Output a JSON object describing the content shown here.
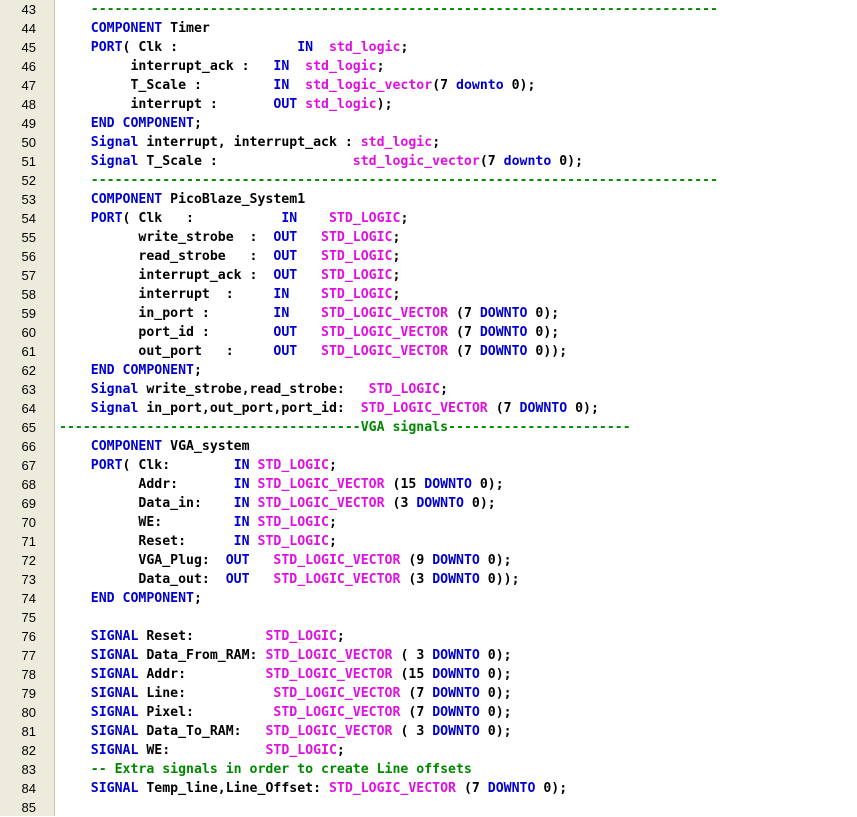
{
  "editor": {
    "colors": {
      "keyword": "#0000cc",
      "type": "#e010e0",
      "comment": "#008800",
      "text": "#000000",
      "gutter": "#ecebdc"
    },
    "lines": [
      {
        "n": "43",
        "t": [
          [
            "cm",
            "    -------------------------------------------------------------------------------"
          ]
        ]
      },
      {
        "n": "44",
        "t": [
          [
            "kw",
            "    COMPONENT"
          ],
          [
            "tx",
            " Timer"
          ]
        ]
      },
      {
        "n": "45",
        "t": [
          [
            "kw",
            "    PORT"
          ],
          [
            "tx",
            "( Clk :               "
          ],
          [
            "kw",
            "IN"
          ],
          [
            "tx",
            "  "
          ],
          [
            "ty",
            "std_logic"
          ],
          [
            "tx",
            ";"
          ]
        ]
      },
      {
        "n": "46",
        "t": [
          [
            "tx",
            "         interrupt_ack :   "
          ],
          [
            "kw",
            "IN"
          ],
          [
            "tx",
            "  "
          ],
          [
            "ty",
            "std_logic"
          ],
          [
            "tx",
            ";"
          ]
        ]
      },
      {
        "n": "47",
        "t": [
          [
            "tx",
            "         T_Scale :         "
          ],
          [
            "kw",
            "IN"
          ],
          [
            "tx",
            "  "
          ],
          [
            "ty",
            "std_logic_vector"
          ],
          [
            "tx",
            "(7 "
          ],
          [
            "kw",
            "downto"
          ],
          [
            "tx",
            " 0);"
          ]
        ]
      },
      {
        "n": "48",
        "t": [
          [
            "tx",
            "         interrupt :       "
          ],
          [
            "kw",
            "OUT"
          ],
          [
            "tx",
            " "
          ],
          [
            "ty",
            "std_logic"
          ],
          [
            "tx",
            ");"
          ]
        ]
      },
      {
        "n": "49",
        "t": [
          [
            "kw",
            "    END COMPONENT"
          ],
          [
            "tx",
            ";"
          ]
        ]
      },
      {
        "n": "50",
        "t": [
          [
            "kw",
            "    Signal"
          ],
          [
            "tx",
            " interrupt, interrupt_ack : "
          ],
          [
            "ty",
            "std_logic"
          ],
          [
            "tx",
            ";"
          ]
        ]
      },
      {
        "n": "51",
        "t": [
          [
            "kw",
            "    Signal"
          ],
          [
            "tx",
            " T_Scale :                 "
          ],
          [
            "ty",
            "std_logic_vector"
          ],
          [
            "tx",
            "(7 "
          ],
          [
            "kw",
            "downto"
          ],
          [
            "tx",
            " 0);"
          ]
        ]
      },
      {
        "n": "52",
        "t": [
          [
            "cm",
            "    -------------------------------------------------------------------------------"
          ]
        ]
      },
      {
        "n": "53",
        "t": [
          [
            "kw",
            "    COMPONENT"
          ],
          [
            "tx",
            " PicoBlaze_System1"
          ]
        ]
      },
      {
        "n": "54",
        "t": [
          [
            "kw",
            "    PORT"
          ],
          [
            "tx",
            "( Clk   :           "
          ],
          [
            "kw",
            "IN"
          ],
          [
            "tx",
            "    "
          ],
          [
            "ty",
            "STD_LOGIC"
          ],
          [
            "tx",
            ";"
          ]
        ]
      },
      {
        "n": "55",
        "t": [
          [
            "tx",
            "          write_strobe  :  "
          ],
          [
            "kw",
            "OUT"
          ],
          [
            "tx",
            "   "
          ],
          [
            "ty",
            "STD_LOGIC"
          ],
          [
            "tx",
            ";"
          ]
        ]
      },
      {
        "n": "56",
        "t": [
          [
            "tx",
            "          read_strobe   :  "
          ],
          [
            "kw",
            "OUT"
          ],
          [
            "tx",
            "   "
          ],
          [
            "ty",
            "STD_LOGIC"
          ],
          [
            "tx",
            ";"
          ]
        ]
      },
      {
        "n": "57",
        "t": [
          [
            "tx",
            "          interrupt_ack :  "
          ],
          [
            "kw",
            "OUT"
          ],
          [
            "tx",
            "   "
          ],
          [
            "ty",
            "STD_LOGIC"
          ],
          [
            "tx",
            ";"
          ]
        ]
      },
      {
        "n": "58",
        "t": [
          [
            "tx",
            "          interrupt  :     "
          ],
          [
            "kw",
            "IN"
          ],
          [
            "tx",
            "    "
          ],
          [
            "ty",
            "STD_LOGIC"
          ],
          [
            "tx",
            ";"
          ]
        ]
      },
      {
        "n": "59",
        "t": [
          [
            "tx",
            "          in_port :        "
          ],
          [
            "kw",
            "IN"
          ],
          [
            "tx",
            "    "
          ],
          [
            "ty",
            "STD_LOGIC_VECTOR"
          ],
          [
            "tx",
            " (7 "
          ],
          [
            "kw",
            "DOWNTO"
          ],
          [
            "tx",
            " 0);"
          ]
        ]
      },
      {
        "n": "60",
        "t": [
          [
            "tx",
            "          port_id :        "
          ],
          [
            "kw",
            "OUT"
          ],
          [
            "tx",
            "   "
          ],
          [
            "ty",
            "STD_LOGIC_VECTOR"
          ],
          [
            "tx",
            " (7 "
          ],
          [
            "kw",
            "DOWNTO"
          ],
          [
            "tx",
            " 0);"
          ]
        ]
      },
      {
        "n": "61",
        "t": [
          [
            "tx",
            "          out_port   :     "
          ],
          [
            "kw",
            "OUT"
          ],
          [
            "tx",
            "   "
          ],
          [
            "ty",
            "STD_LOGIC_VECTOR"
          ],
          [
            "tx",
            " (7 "
          ],
          [
            "kw",
            "DOWNTO"
          ],
          [
            "tx",
            " 0));"
          ]
        ]
      },
      {
        "n": "62",
        "t": [
          [
            "kw",
            "    END COMPONENT"
          ],
          [
            "tx",
            ";"
          ]
        ]
      },
      {
        "n": "63",
        "t": [
          [
            "kw",
            "    Signal"
          ],
          [
            "tx",
            " write_strobe,read_strobe:   "
          ],
          [
            "ty",
            "STD_LOGIC"
          ],
          [
            "tx",
            ";"
          ]
        ]
      },
      {
        "n": "64",
        "t": [
          [
            "kw",
            "    Signal"
          ],
          [
            "tx",
            " in_port,out_port,port_id:  "
          ],
          [
            "ty",
            "STD_LOGIC_VECTOR"
          ],
          [
            "tx",
            " (7 "
          ],
          [
            "kw",
            "DOWNTO"
          ],
          [
            "tx",
            " 0);"
          ]
        ]
      },
      {
        "n": "65",
        "t": [
          [
            "cm",
            "--------------------------------------VGA signals-----------------------"
          ]
        ]
      },
      {
        "n": "66",
        "t": [
          [
            "kw",
            "    COMPONENT"
          ],
          [
            "tx",
            " VGA_system"
          ]
        ]
      },
      {
        "n": "67",
        "t": [
          [
            "kw",
            "    PORT"
          ],
          [
            "tx",
            "( Clk:        "
          ],
          [
            "kw",
            "IN"
          ],
          [
            "tx",
            " "
          ],
          [
            "ty",
            "STD_LOGIC"
          ],
          [
            "tx",
            ";"
          ]
        ]
      },
      {
        "n": "68",
        "t": [
          [
            "tx",
            "          Addr:       "
          ],
          [
            "kw",
            "IN"
          ],
          [
            "tx",
            " "
          ],
          [
            "ty",
            "STD_LOGIC_VECTOR"
          ],
          [
            "tx",
            " (15 "
          ],
          [
            "kw",
            "DOWNTO"
          ],
          [
            "tx",
            " 0);"
          ]
        ]
      },
      {
        "n": "69",
        "t": [
          [
            "tx",
            "          Data_in:    "
          ],
          [
            "kw",
            "IN"
          ],
          [
            "tx",
            " "
          ],
          [
            "ty",
            "STD_LOGIC_VECTOR"
          ],
          [
            "tx",
            " (3 "
          ],
          [
            "kw",
            "DOWNTO"
          ],
          [
            "tx",
            " 0);"
          ]
        ]
      },
      {
        "n": "70",
        "t": [
          [
            "tx",
            "          WE:         "
          ],
          [
            "kw",
            "IN"
          ],
          [
            "tx",
            " "
          ],
          [
            "ty",
            "STD_LOGIC"
          ],
          [
            "tx",
            ";"
          ]
        ]
      },
      {
        "n": "71",
        "t": [
          [
            "tx",
            "          Reset:      "
          ],
          [
            "kw",
            "IN"
          ],
          [
            "tx",
            " "
          ],
          [
            "ty",
            "STD_LOGIC"
          ],
          [
            "tx",
            ";"
          ]
        ]
      },
      {
        "n": "72",
        "t": [
          [
            "tx",
            "          VGA_Plug:  "
          ],
          [
            "kw",
            "OUT"
          ],
          [
            "tx",
            "   "
          ],
          [
            "ty",
            "STD_LOGIC_VECTOR"
          ],
          [
            "tx",
            " (9 "
          ],
          [
            "kw",
            "DOWNTO"
          ],
          [
            "tx",
            " 0);"
          ]
        ]
      },
      {
        "n": "73",
        "t": [
          [
            "tx",
            "          Data_out:  "
          ],
          [
            "kw",
            "OUT"
          ],
          [
            "tx",
            "   "
          ],
          [
            "ty",
            "STD_LOGIC_VECTOR"
          ],
          [
            "tx",
            " (3 "
          ],
          [
            "kw",
            "DOWNTO"
          ],
          [
            "tx",
            " 0));"
          ]
        ]
      },
      {
        "n": "74",
        "t": [
          [
            "kw",
            "    END COMPONENT"
          ],
          [
            "tx",
            ";"
          ]
        ]
      },
      {
        "n": "75",
        "t": []
      },
      {
        "n": "76",
        "t": [
          [
            "kw",
            "    SIGNAL"
          ],
          [
            "tx",
            " Reset:         "
          ],
          [
            "ty",
            "STD_LOGIC"
          ],
          [
            "tx",
            ";"
          ]
        ]
      },
      {
        "n": "77",
        "t": [
          [
            "kw",
            "    SIGNAL"
          ],
          [
            "tx",
            " Data_From_RAM: "
          ],
          [
            "ty",
            "STD_LOGIC_VECTOR"
          ],
          [
            "tx",
            " ( 3 "
          ],
          [
            "kw",
            "DOWNTO"
          ],
          [
            "tx",
            " 0);"
          ]
        ]
      },
      {
        "n": "78",
        "t": [
          [
            "kw",
            "    SIGNAL"
          ],
          [
            "tx",
            " Addr:          "
          ],
          [
            "ty",
            "STD_LOGIC_VECTOR"
          ],
          [
            "tx",
            " (15 "
          ],
          [
            "kw",
            "DOWNTO"
          ],
          [
            "tx",
            " 0);"
          ]
        ]
      },
      {
        "n": "79",
        "t": [
          [
            "kw",
            "    SIGNAL"
          ],
          [
            "tx",
            " Line:           "
          ],
          [
            "ty",
            "STD_LOGIC_VECTOR"
          ],
          [
            "tx",
            " (7 "
          ],
          [
            "kw",
            "DOWNTO"
          ],
          [
            "tx",
            " 0);"
          ]
        ]
      },
      {
        "n": "80",
        "t": [
          [
            "kw",
            "    SIGNAL"
          ],
          [
            "tx",
            " Pixel:          "
          ],
          [
            "ty",
            "STD_LOGIC_VECTOR"
          ],
          [
            "tx",
            " (7 "
          ],
          [
            "kw",
            "DOWNTO"
          ],
          [
            "tx",
            " 0);"
          ]
        ]
      },
      {
        "n": "81",
        "t": [
          [
            "kw",
            "    SIGNAL"
          ],
          [
            "tx",
            " Data_To_RAM:   "
          ],
          [
            "ty",
            "STD_LOGIC_VECTOR"
          ],
          [
            "tx",
            " ( 3 "
          ],
          [
            "kw",
            "DOWNTO"
          ],
          [
            "tx",
            " 0);"
          ]
        ]
      },
      {
        "n": "82",
        "t": [
          [
            "kw",
            "    SIGNAL"
          ],
          [
            "tx",
            " WE:            "
          ],
          [
            "ty",
            "STD_LOGIC"
          ],
          [
            "tx",
            ";"
          ]
        ]
      },
      {
        "n": "83",
        "t": [
          [
            "cm",
            "    -- Extra signals in order to create Line offsets"
          ]
        ]
      },
      {
        "n": "84",
        "t": [
          [
            "kw",
            "    SIGNAL"
          ],
          [
            "tx",
            " Temp_line,Line_Offset: "
          ],
          [
            "ty",
            "STD_LOGIC_VECTOR"
          ],
          [
            "tx",
            " (7 "
          ],
          [
            "kw",
            "DOWNTO"
          ],
          [
            "tx",
            " 0);"
          ]
        ]
      },
      {
        "n": "85",
        "t": []
      }
    ]
  }
}
